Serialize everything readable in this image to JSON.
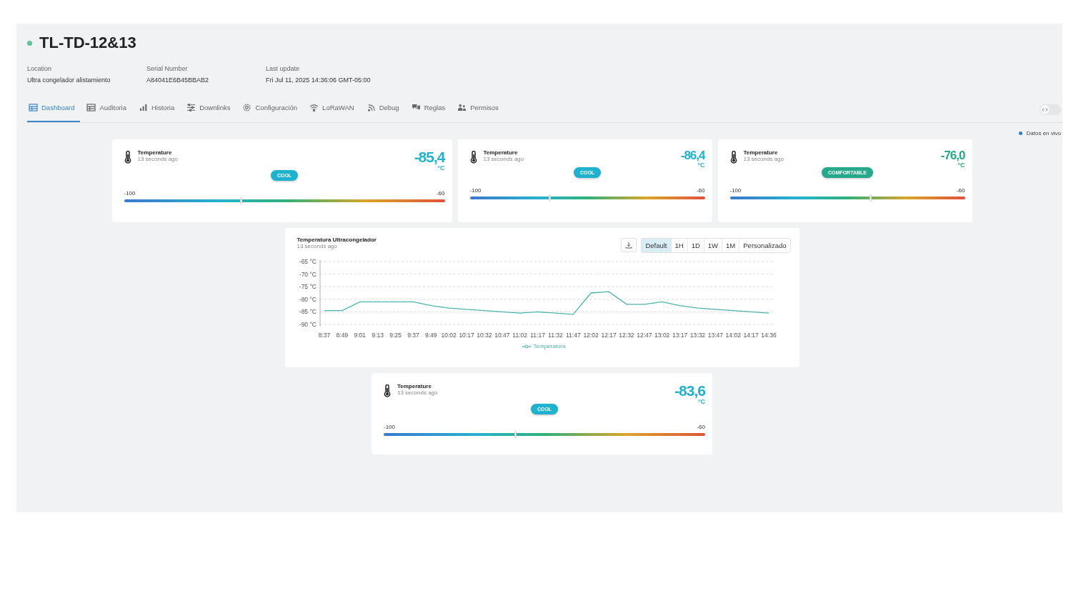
{
  "device": {
    "name": "TL-TD-12&13",
    "online": true
  },
  "info": [
    {
      "label": "Location",
      "value": "Ultra congelador alistamiento"
    },
    {
      "label": "Serial Number",
      "value": "A84041E6B45BBAB2"
    },
    {
      "label": "Last update",
      "value": "Fri Jul 11, 2025 14:36:06 GMT-05:00"
    }
  ],
  "tabs": [
    {
      "label": "Dashboard",
      "selected": true
    },
    {
      "label": "Auditoria",
      "selected": false
    },
    {
      "label": "Historia",
      "selected": false
    },
    {
      "label": "Downlinks",
      "selected": false
    },
    {
      "label": "Configuración",
      "selected": false
    },
    {
      "label": "LoRaWAN",
      "selected": false
    },
    {
      "label": "Debug",
      "selected": false
    },
    {
      "label": "Reglas",
      "selected": false
    },
    {
      "label": "Permisos",
      "selected": false
    }
  ],
  "code_toggle": {
    "on": false
  },
  "live": {
    "label": "Datos en vivo"
  },
  "cards": [
    {
      "title": "Temperature",
      "ago": "13 seconds ago",
      "value": "-85,4",
      "unit": "°C",
      "status": "COOL",
      "color": "#1fb2cf",
      "min": "-100",
      "max": "-60",
      "level": 0.365
    },
    {
      "title": "Temperature",
      "ago": "13 seconds ago",
      "value": "-86,4",
      "unit": "°C",
      "status": "COOL",
      "color": "#1fb2cf",
      "min": "-100",
      "max": "-60",
      "level": 0.34
    },
    {
      "title": "Temperature",
      "ago": "13 seconds ago",
      "value": "-76,0",
      "unit": "°C",
      "status": "COMFORTABLE",
      "color": "#25a98a",
      "min": "-100",
      "max": "-60",
      "level": 0.6
    }
  ],
  "chart": {
    "title": "Temperatura Ultracongelador",
    "ago": "13 seconds ago",
    "ranges": [
      {
        "label": "Default",
        "selected": true
      },
      {
        "label": "1H",
        "selected": false
      },
      {
        "label": "1D",
        "selected": false
      },
      {
        "label": "1W",
        "selected": false
      },
      {
        "label": "1M",
        "selected": false
      },
      {
        "label": "Personalizado",
        "selected": false
      }
    ],
    "chart_data": {
      "type": "line",
      "categories": [
        "8:37",
        "8:49",
        "9:01",
        "9:13",
        "9:25",
        "9:37",
        "9:49",
        "10:02",
        "10:17",
        "10:32",
        "10:47",
        "11:02",
        "11:17",
        "11:32",
        "11:47",
        "12:02",
        "12:17",
        "12:32",
        "12:47",
        "13:02",
        "13:17",
        "13:32",
        "13:47",
        "14:02",
        "14:17",
        "14:36"
      ],
      "series": [
        {
          "name": "Temperatura",
          "color": "#4bb3b0",
          "values": [
            -84.5,
            -84.5,
            -81,
            -81,
            -81,
            -81,
            -82.5,
            -83.5,
            -84,
            -84.5,
            -85,
            -85.5,
            -85,
            -85.5,
            -86,
            -77.5,
            -77,
            -82,
            -82,
            -81,
            -82.5,
            -83.5,
            -84,
            -84.5,
            -85,
            -85.5
          ]
        }
      ],
      "ylim": [
        -90,
        -65
      ],
      "grid": true,
      "yticks": [
        {
          "value": -65,
          "label": "-65 °C"
        },
        {
          "value": -70,
          "label": "-70 °C"
        },
        {
          "value": -75,
          "label": "-75 °C"
        },
        {
          "value": -80,
          "label": "-80 °C"
        },
        {
          "value": -85,
          "label": "-85 °C"
        },
        {
          "value": -90,
          "label": "-90 °C"
        }
      ]
    }
  },
  "bottom_card": {
    "title": "Temperature",
    "ago": "13 seconds ago",
    "value": "-83,6",
    "unit": "°C",
    "status": "COOL",
    "color": "#1fb2cf",
    "min": "-100",
    "max": "-60",
    "level": 0.41
  }
}
